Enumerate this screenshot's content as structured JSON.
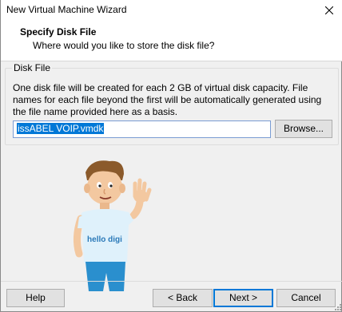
{
  "window": {
    "title": "New Virtual Machine Wizard",
    "close_icon": "close-icon"
  },
  "header": {
    "title": "Specify Disk File",
    "subtitle": "Where would you like to store the disk file?"
  },
  "disk_file": {
    "legend": "Disk File",
    "description": "One disk file will be created for each 2 GB of virtual disk capacity. File names for each file beyond the first will be automatically generated using the file name provided here as a basis.",
    "file_name": "issABEL VOIP.vmdk",
    "browse_label": "Browse..."
  },
  "mascot": {
    "shirt_text": "hello digi"
  },
  "footer": {
    "help_label": "Help",
    "back_label": "< Back",
    "next_label": "Next >",
    "cancel_label": "Cancel"
  },
  "colors": {
    "accent": "#0078d7",
    "selection": "#0078d7",
    "shirt": "#dff1fb",
    "pants": "#2a8fce"
  }
}
